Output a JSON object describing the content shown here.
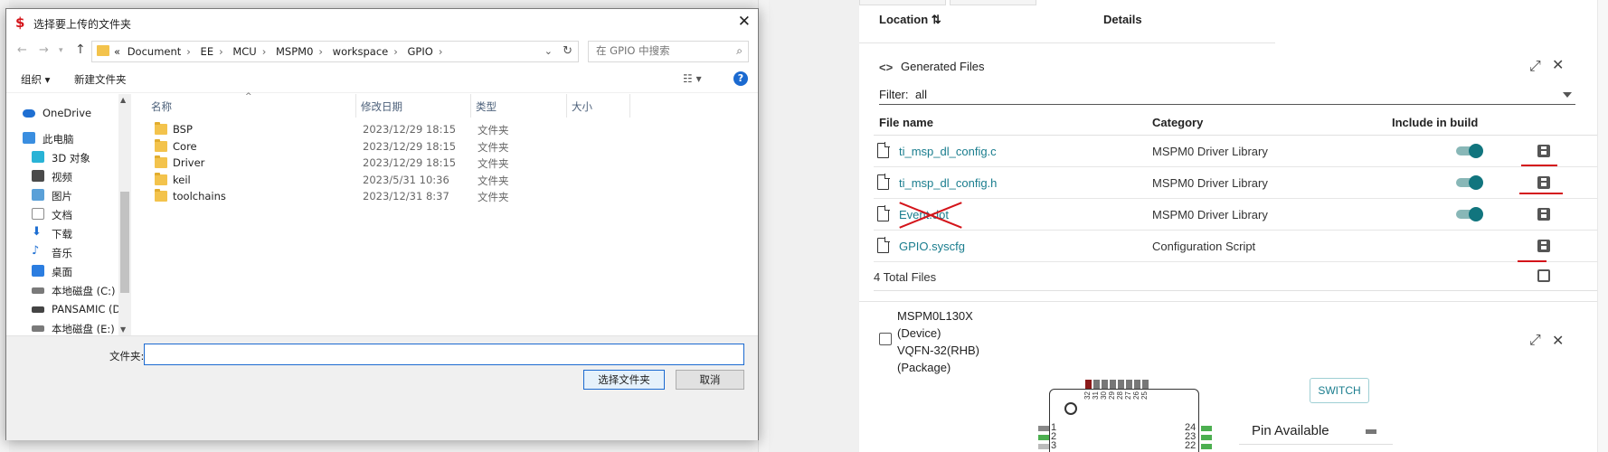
{
  "dialog": {
    "title": "选择要上传的文件夹",
    "address": [
      "«",
      "Document",
      "EE",
      "MCU",
      "MSPM0",
      "workspace",
      "GPIO"
    ],
    "search_placeholder": "在 GPIO 中搜索",
    "toolbar": {
      "organize": "组织 ▾",
      "new_folder": "新建文件夹"
    },
    "nav": [
      {
        "label": "OneDrive",
        "icon": "onedrive-icon",
        "color": "#1e6fd2"
      },
      {
        "label": "此电脑",
        "icon": "computer-icon",
        "color": "#3a8ee0"
      },
      {
        "label": "3D 对象",
        "icon": "3d-objects-icon",
        "color": "#29b3d6"
      },
      {
        "label": "视频",
        "icon": "video-icon",
        "color": "#4a4a4a"
      },
      {
        "label": "图片",
        "icon": "picture-icon",
        "color": "#5aa0d8"
      },
      {
        "label": "文档",
        "icon": "document-icon",
        "color": "#8c8c8c"
      },
      {
        "label": "下载",
        "icon": "download-icon",
        "color": "#1e6fd2"
      },
      {
        "label": "音乐",
        "icon": "music-icon",
        "color": "#1e6fd2"
      },
      {
        "label": "桌面",
        "icon": "desktop-icon",
        "color": "#2b7de0"
      },
      {
        "label": "本地磁盘 (C:)",
        "icon": "drive-c-icon",
        "color": "#7a7a7a"
      },
      {
        "label": "PANSAMIC (D:)",
        "icon": "drive-d-icon",
        "color": "#444444"
      },
      {
        "label": "本地磁盘 (E:)",
        "icon": "drive-e-icon",
        "color": "#7a7a7a"
      }
    ],
    "columns": {
      "name": "名称",
      "date": "修改日期",
      "type": "类型",
      "size": "大小"
    },
    "files": [
      {
        "name": "BSP",
        "date": "2023/12/29 18:15",
        "type": "文件夹"
      },
      {
        "name": "Core",
        "date": "2023/12/29 18:15",
        "type": "文件夹"
      },
      {
        "name": "Driver",
        "date": "2023/12/29 18:15",
        "type": "文件夹"
      },
      {
        "name": "keil",
        "date": "2023/5/31 10:36",
        "type": "文件夹"
      },
      {
        "name": "toolchains",
        "date": "2023/12/31 8:37",
        "type": "文件夹"
      }
    ],
    "folder_label": "文件夹:",
    "folder_value": "",
    "select_button": "选择文件夹",
    "cancel_button": "取消"
  },
  "app": {
    "top_headers": {
      "location": "Location ⇅",
      "details": "Details"
    },
    "generated_files": {
      "title": "Generated Files",
      "filter_label": "Filter:",
      "filter_value": "all",
      "headers": {
        "file_name": "File name",
        "category": "Category",
        "include": "Include in build"
      },
      "rows": [
        {
          "name": "ti_msp_dl_config.c",
          "category": "MSPM0 Driver Library",
          "toggle": true,
          "marked": "underline"
        },
        {
          "name": "ti_msp_dl_config.h",
          "category": "MSPM0 Driver Library",
          "toggle": true,
          "marked": "underline"
        },
        {
          "name": "Event.dot",
          "category": "MSPM0 Driver Library",
          "toggle": true,
          "marked": "crossed"
        },
        {
          "name": "GPIO.syscfg",
          "category": "Configuration Script",
          "toggle": false,
          "marked": "underline"
        }
      ],
      "total": "4 Total Files"
    },
    "device": {
      "lines": [
        "MSPM0L130X",
        "(Device)",
        "VQFN-32(RHB)",
        "(Package)"
      ],
      "switch_button": "SWITCH",
      "pin_available": "Pin Available",
      "top_pins": [
        "32",
        "31",
        "30",
        "29",
        "28",
        "27",
        "26",
        "25"
      ],
      "left_pins": [
        "1",
        "2",
        "3"
      ],
      "right_pins": [
        "24",
        "23",
        "22"
      ]
    },
    "colors": {
      "accent": "#1a7d8e",
      "toggle": "#11757e",
      "mark": "#d4141a",
      "pin_used": "#4caf50",
      "pin_red": "#8b1a1a"
    }
  }
}
